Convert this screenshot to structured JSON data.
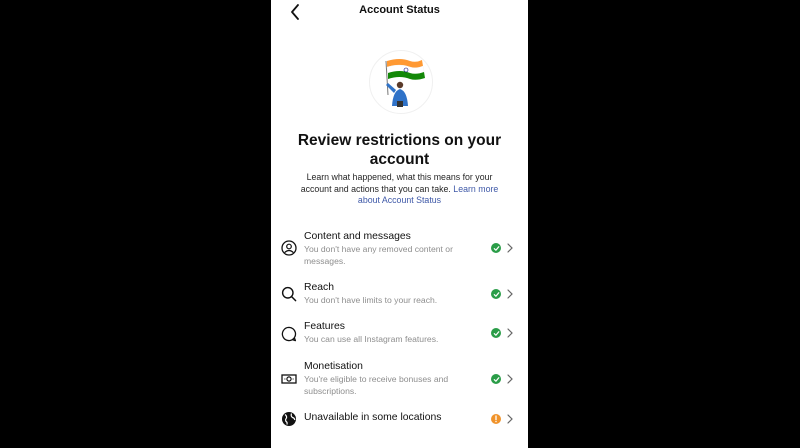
{
  "header": {
    "title": "Account Status"
  },
  "intro": {
    "heading": "Review restrictions on your account",
    "description": "Learn what happened, what this means for your account and actions that you can take.",
    "link": "Learn more about Account Status"
  },
  "items": [
    {
      "title": "Content and messages",
      "subtitle": "You don't have any removed content or messages.",
      "icon": "user-circle-icon",
      "status": "ok"
    },
    {
      "title": "Reach",
      "subtitle": "You don't have limits to your reach.",
      "icon": "search-icon",
      "status": "ok"
    },
    {
      "title": "Features",
      "subtitle": "You can use all Instagram features.",
      "icon": "speech-bubble-icon",
      "status": "ok"
    },
    {
      "title": "Monetisation",
      "subtitle": "You're eligible to receive bonuses and subscriptions.",
      "icon": "banknote-icon",
      "status": "ok"
    },
    {
      "title": "Unavailable in some locations",
      "subtitle": "",
      "icon": "globe-icon",
      "status": "warning"
    }
  ],
  "colors": {
    "ok": "#2a9d48",
    "warning": "#f0932b",
    "link": "#3f59a8"
  }
}
